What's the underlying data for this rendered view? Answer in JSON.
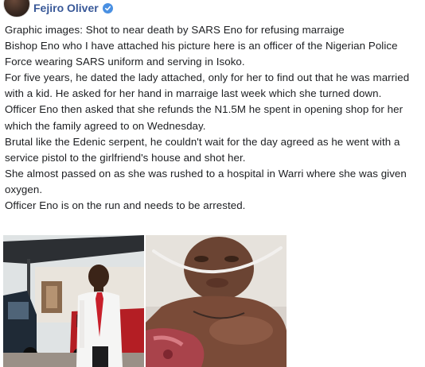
{
  "post": {
    "author": "Fejiro Oliver",
    "paragraphs": [
      "Graphic images: Shot to near death by SARS Eno for refusing marraige",
      "Bishop Eno who I have attached his picture here is an officer of the Nigerian Police Force wearing SARS uniform and serving in Isoko.",
      "For five years, he dated the lady attached, only for her to find out that he was married with a kid. He asked for her hand in marraige last week which she turned down.",
      "Officer Eno then asked that she refunds the N1.5M he spent in opening shop for her which the family agreed to on Wednesday.",
      "Brutal like the Edenic serpent, he couldn't wait for the day agreed as he went with a service pistol to the girlfriend's house and shot her.",
      "She almost passed on as she was rushed to a hospital in Warri where she was given oxygen.",
      "Officer Eno is on the run and needs to be arrested."
    ],
    "verified_icon": "verified-badge-icon",
    "colors": {
      "author": "#385898",
      "verified": "#4a90e2",
      "text": "#1c1e21"
    }
  },
  "photos": [
    {
      "name": "photo-officer",
      "icon": "photo-man-in-white-shirt-red-tie"
    },
    {
      "name": "photo-victim",
      "icon": "photo-woman-hospital-oxygen"
    }
  ]
}
